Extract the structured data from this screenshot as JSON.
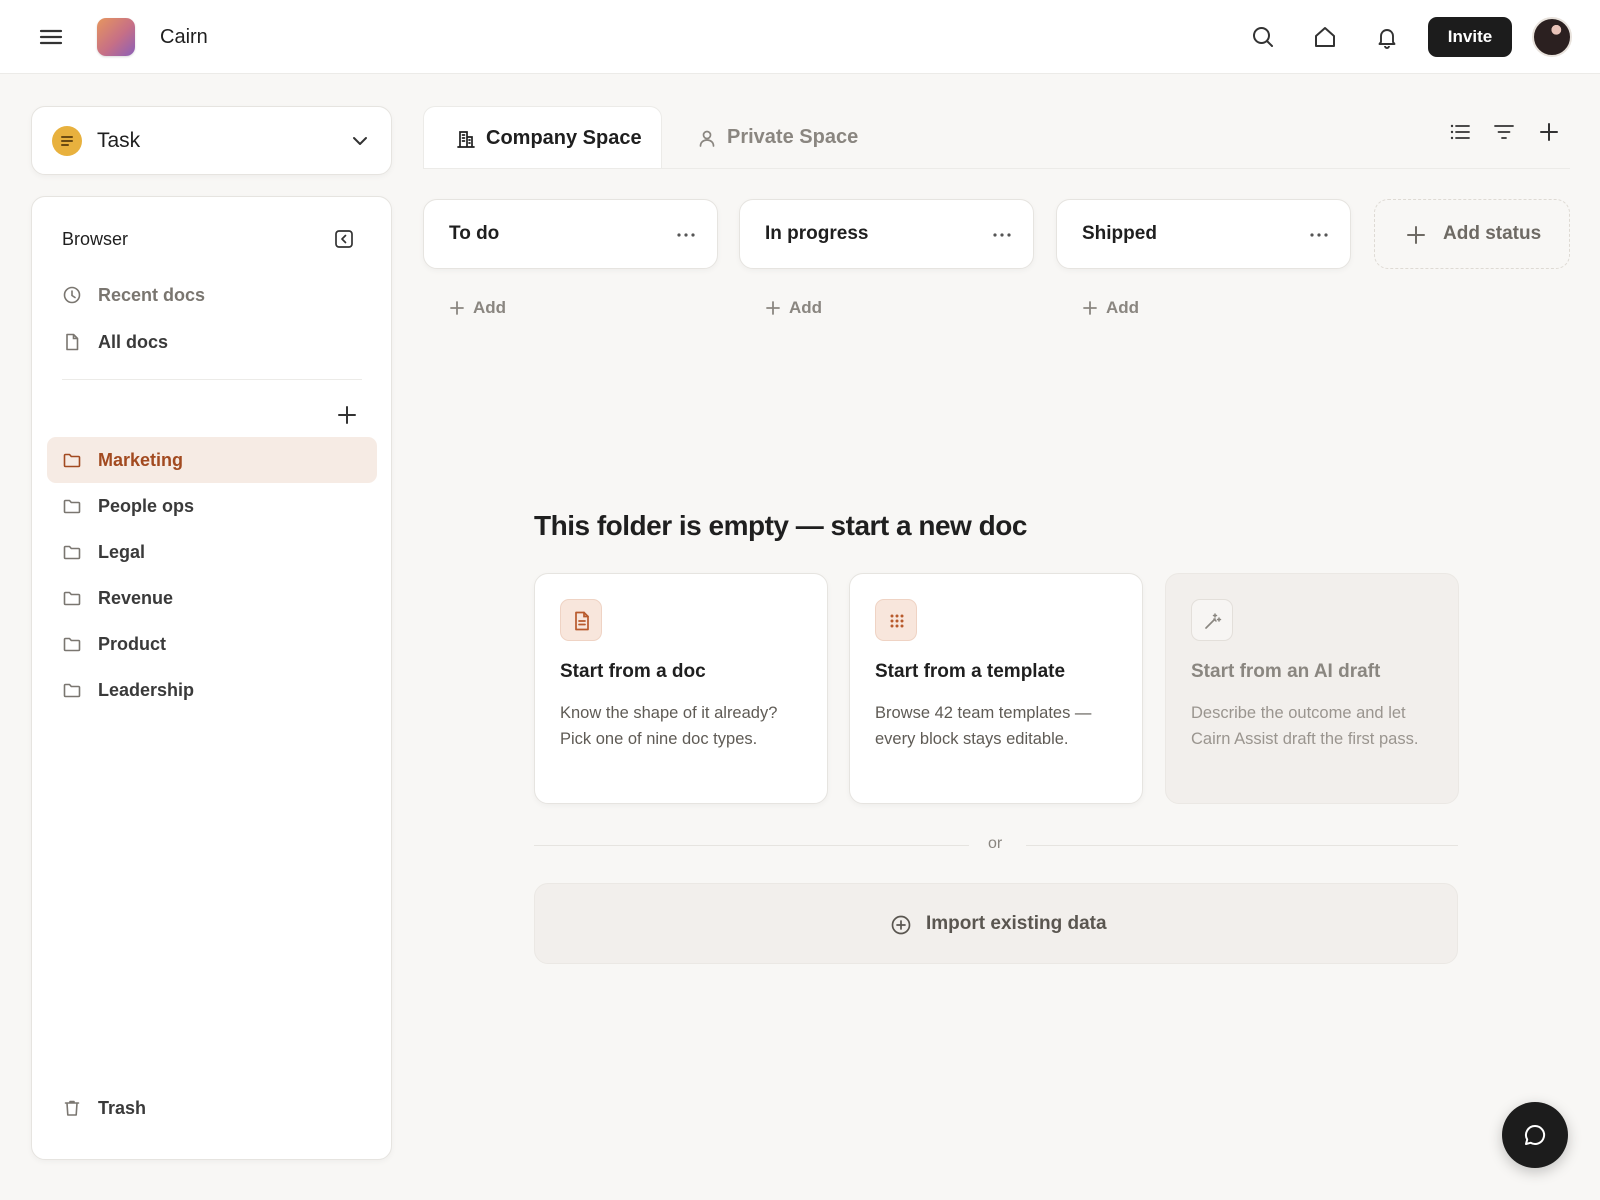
{
  "app": {
    "name": "Cairn"
  },
  "topbar": {
    "menu_icon": "menu-icon",
    "search_icon": "search-icon",
    "home_icon": "home-icon",
    "bell_icon": "bell-icon",
    "invite_label": "Invite"
  },
  "sidebar": {
    "task_select": {
      "label": "Task",
      "icon": "task-icon",
      "color": "#e8b13e"
    },
    "browser_title": "Browser",
    "nav": [
      {
        "label": "Recent docs",
        "icon": "clock-icon"
      },
      {
        "label": "All docs",
        "icon": "doc-icon"
      }
    ],
    "folders": [
      {
        "label": "Marketing",
        "icon": "folder-icon",
        "active": true
      },
      {
        "label": "People ops",
        "icon": "folder-icon"
      },
      {
        "label": "Legal",
        "icon": "folder-icon"
      },
      {
        "label": "Revenue",
        "icon": "folder-icon"
      },
      {
        "label": "Product",
        "icon": "folder-icon"
      },
      {
        "label": "Leadership",
        "icon": "folder-icon"
      }
    ],
    "trash_label": "Trash"
  },
  "tabs": [
    {
      "label": "Company Space",
      "icon": "building-icon",
      "active": true
    },
    {
      "label": "Private Space",
      "icon": "person-icon",
      "active": false
    }
  ],
  "statuses": [
    {
      "label": "To do",
      "add_label": "Add"
    },
    {
      "label": "In progress",
      "add_label": "Add"
    },
    {
      "label": "Shipped",
      "add_label": "Add"
    }
  ],
  "add_status_label": "Add status",
  "empty_state": {
    "heading": "This folder is empty — start a new doc",
    "cards": [
      {
        "title": "Start from a doc",
        "description": "Know the shape of it already? Pick one of nine doc types.",
        "icon": "document-icon"
      },
      {
        "title": "Start from a template",
        "description": "Browse 42 team templates — every block stays editable.",
        "icon": "grid-icon"
      },
      {
        "title": "Start from an AI draft",
        "description": "Describe the outcome and let Cairn Assist draft the first pass.",
        "icon": "wand-icon"
      }
    ],
    "or_label": "or",
    "import_label": "Import existing data"
  },
  "colors": {
    "accent": "#a24a20",
    "accent_bg": "#f6ebe4",
    "dark": "#1c1c1c"
  }
}
